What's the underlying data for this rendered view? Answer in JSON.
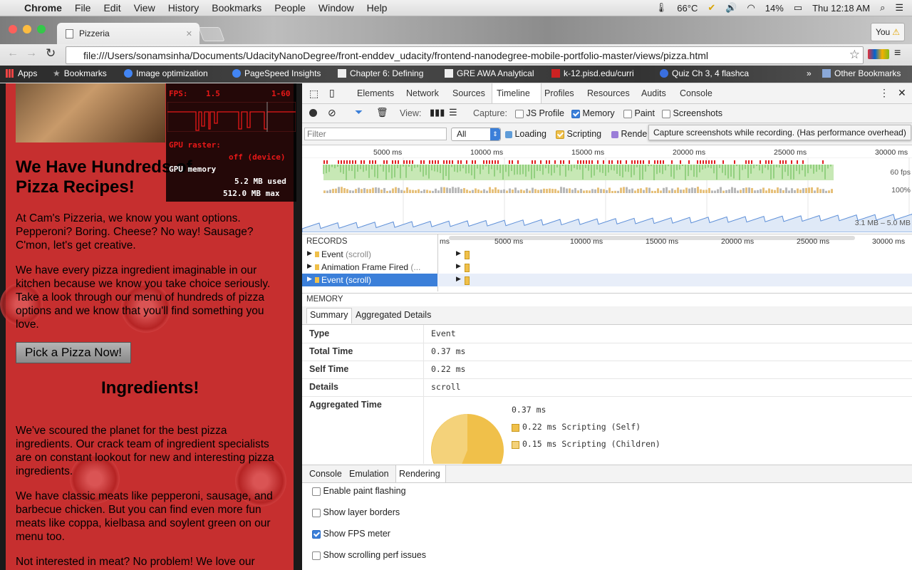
{
  "menubar": {
    "app": "Chrome",
    "items": [
      "File",
      "Edit",
      "View",
      "History",
      "Bookmarks",
      "People",
      "Window",
      "Help"
    ],
    "temp": "66°C",
    "battery": "14%",
    "clock": "Thu 12:18 AM"
  },
  "browser": {
    "tab_title": "Pizzeria",
    "profile": "You",
    "url": "file:///Users/sonamsinha/Documents/UdacityNanoDegree/front-enddev_udacity/frontend-nanodegree-mobile-portfolio-master/views/pizza.html",
    "bookmarks": [
      "Apps",
      "Bookmarks",
      "Image optimization",
      "PageSpeed Insights",
      "Chapter 6: Defining",
      "GRE AWA Analytical",
      "k-12.pisd.edu/curri",
      "Quiz Ch 3, 4 flashca",
      "»",
      "Other Bookmarks"
    ]
  },
  "fps_meter": {
    "fps_label": "FPS:",
    "fps_value": "1.5",
    "range": "1-60",
    "gpu_raster_label": "GPU raster:",
    "gpu_raster_value": "off (device)",
    "gpu_memory_label": "GPU memory",
    "gpu_used": "5.2 MB used",
    "gpu_max": "512.0 MB max"
  },
  "page": {
    "heading1": "We Have Hundreds of Pizza Recipes!",
    "p1": "At Cam's Pizzeria, we know you want options. Pepperoni? Boring. Cheese? No way! Sausage? C'mon, let's get creative.",
    "p2": "We have every pizza ingredient imaginable in our kitchen because we know you take choice seriously. Take a look through our menu of hundreds of pizza options and we know that you'll find something you love.",
    "button": "Pick a Pizza Now!",
    "heading2": "Ingredients!",
    "p3": "We've scoured the planet for the best pizza ingredients. Our crack team of ingredient specialists are on constant lookout for new and interesting pizza ingredients.",
    "p4": "We have classic meats like pepperoni, sausage, and barbecue chicken. But you can find even more fun meats like coppa, kielbasa and soylent green on our menu too.",
    "p5": "Not interested in meat? No problem! We love our"
  },
  "devtools": {
    "tabs": [
      "Elements",
      "Network",
      "Sources",
      "Timeline",
      "Profiles",
      "Resources",
      "Audits",
      "Console"
    ],
    "active_tab": "Timeline",
    "view_label": "View:",
    "capture_label": "Capture:",
    "capture_opts": [
      "JS Profile",
      "Memory",
      "Paint",
      "Screenshots"
    ],
    "filter_placeholder": "Filter",
    "filter_select": "All",
    "categories": [
      "Loading",
      "Scripting",
      "Rende"
    ],
    "category_colors": [
      "#5f9cd8",
      "#f0c04a",
      "#9b7ed8"
    ],
    "tooltip": "Capture screenshots while recording. (Has performance overhead)",
    "overview_ticks": [
      "5000 ms",
      "10000 ms",
      "15000 ms",
      "20000 ms",
      "25000 ms",
      "30000 ms"
    ],
    "fps_label": "60 fps",
    "cpu_label": "100%",
    "mem_label": "3.1 MB – 5.0 MB",
    "records_header": "RECORDS",
    "records_ms": "ms",
    "records_ticks": [
      "5000 ms",
      "10000 ms",
      "15000 ms",
      "20000 ms",
      "25000 ms",
      "30000 ms"
    ],
    "records": [
      {
        "name": "Event",
        "detail": "(scroll)"
      },
      {
        "name": "Animation Frame Fired",
        "detail": "(..."
      },
      {
        "name": "Event",
        "detail": "(scroll)"
      }
    ],
    "memory_header": "MEMORY",
    "detail_tabs": [
      "Summary",
      "Aggregated Details"
    ],
    "summary": {
      "type_label": "Type",
      "type_value": "Event",
      "total_label": "Total Time",
      "total_value": "0.37 ms",
      "self_label": "Self Time",
      "self_value": "0.22 ms",
      "details_label": "Details",
      "details_value": "scroll",
      "agg_label": "Aggregated Time",
      "agg_total": "0.37 ms",
      "legend": [
        "0.22 ms Scripting (Self)",
        "0.15 ms Scripting (Children)"
      ]
    },
    "drawer_tabs": [
      "Console",
      "Emulation",
      "Rendering"
    ],
    "rendering_opts": [
      {
        "label": "Enable paint flashing",
        "checked": false
      },
      {
        "label": "Show layer borders",
        "checked": false
      },
      {
        "label": "Show FPS meter",
        "checked": true
      },
      {
        "label": "Show scrolling perf issues",
        "checked": false
      }
    ]
  }
}
